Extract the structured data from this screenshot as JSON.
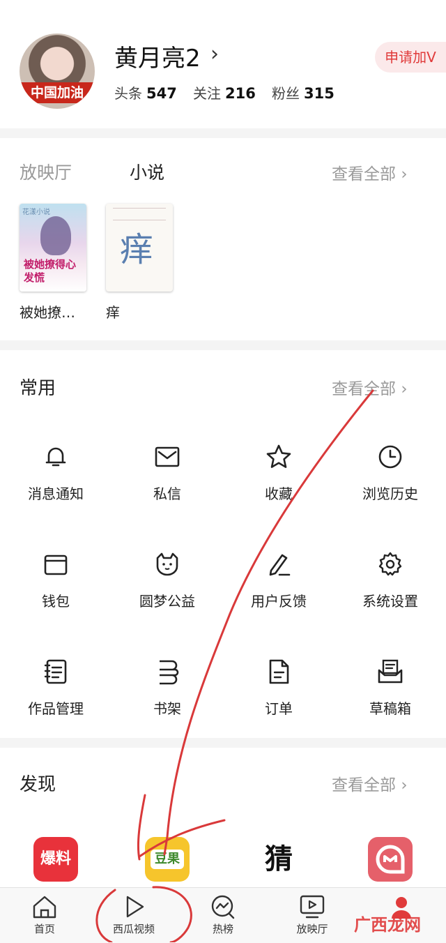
{
  "profile": {
    "name": "黄月亮2",
    "avatar_text": "中国加油",
    "apply_label": "申请加V",
    "stats": [
      {
        "label": "头条",
        "value": "547"
      },
      {
        "label": "关注",
        "value": "216"
      },
      {
        "label": "粉丝",
        "value": "315"
      }
    ]
  },
  "media": {
    "tabs": [
      "放映厅",
      "小说"
    ],
    "see_all": "查看全部",
    "books": [
      {
        "title": "被她撩…",
        "cover_text": "被她撩得心发慌",
        "cover_top": "花漾小说"
      },
      {
        "title": "痒",
        "cover_text": "痒"
      }
    ]
  },
  "common": {
    "title": "常用",
    "see_all": "查看全部",
    "items": [
      {
        "label": "消息通知",
        "icon": "bell-icon"
      },
      {
        "label": "私信",
        "icon": "mail-icon"
      },
      {
        "label": "收藏",
        "icon": "star-icon"
      },
      {
        "label": "浏览历史",
        "icon": "clock-icon"
      },
      {
        "label": "钱包",
        "icon": "wallet-icon"
      },
      {
        "label": "圆梦公益",
        "icon": "charity-icon"
      },
      {
        "label": "用户反馈",
        "icon": "pen-icon"
      },
      {
        "label": "系统设置",
        "icon": "gear-icon"
      },
      {
        "label": "作品管理",
        "icon": "notebook-icon"
      },
      {
        "label": "书架",
        "icon": "bookshelf-icon"
      },
      {
        "label": "订单",
        "icon": "document-icon"
      },
      {
        "label": "草稿箱",
        "icon": "draftbox-icon"
      }
    ]
  },
  "discover": {
    "title": "发现",
    "see_all": "查看全部",
    "apps": [
      {
        "name": "爆料",
        "icon": "baoliao-app-icon"
      },
      {
        "name": "豆果",
        "icon": "douguo-app-icon"
      },
      {
        "name": "猜",
        "icon": "guess-app-icon"
      },
      {
        "name": "",
        "icon": "chat-app-icon"
      }
    ]
  },
  "tabbar": {
    "items": [
      {
        "label": "首页",
        "icon": "home-icon"
      },
      {
        "label": "西瓜视频",
        "icon": "play-icon"
      },
      {
        "label": "热榜",
        "icon": "trending-icon"
      },
      {
        "label": "放映厅",
        "icon": "tv-icon"
      },
      {
        "label": "",
        "icon": "person-icon"
      }
    ]
  },
  "watermark": "广西龙网",
  "colors": {
    "accent_red": "#e03b3b",
    "apply_bg": "#fbe9ea",
    "muted_text": "#9a9a9a",
    "annotation_red": "#d9393a"
  }
}
